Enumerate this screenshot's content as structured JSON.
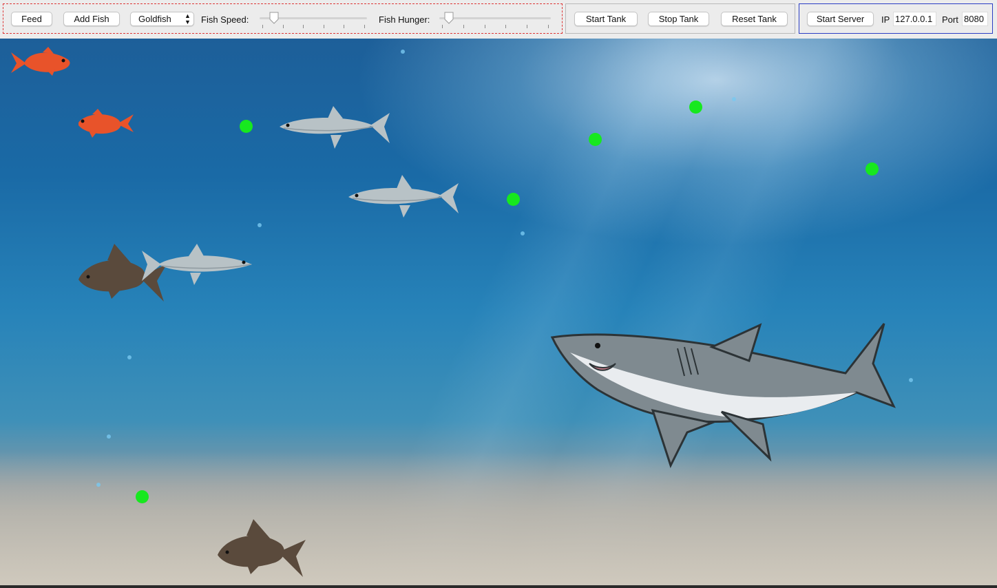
{
  "toolbar": {
    "feed_label": "Feed",
    "add_fish_label": "Add Fish",
    "fish_type": {
      "selected": "Goldfish"
    },
    "speed": {
      "label": "Fish Speed:",
      "value": 0.1
    },
    "hunger": {
      "label": "Fish Hunger:",
      "value": 0.05
    },
    "start_tank_label": "Start Tank",
    "stop_tank_label": "Stop Tank",
    "reset_tank_label": "Reset Tank",
    "start_server_label": "Start Server",
    "ip_label": "IP",
    "ip_value": "127.0.0.1",
    "port_label": "Port",
    "port_value": "8080"
  },
  "tank": {
    "food_color": "#17e81f",
    "goldfish_color": "#e8532a",
    "salmon_color": "#b8c2c6",
    "carp_color": "#5a4a3c",
    "shark_color": "#7f8a90"
  }
}
